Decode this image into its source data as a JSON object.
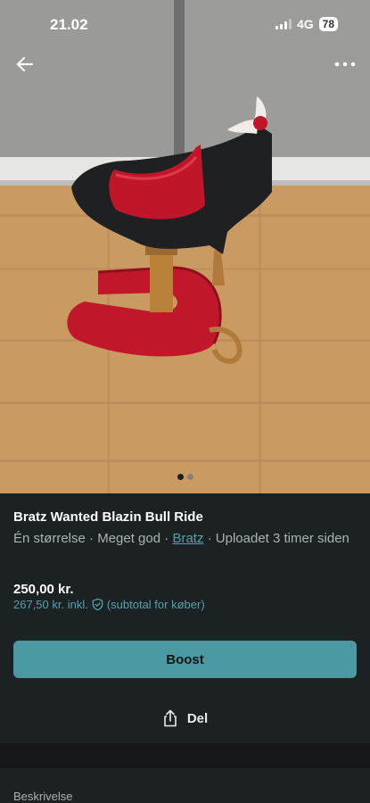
{
  "status_bar": {
    "time": "21.02",
    "network": "4G",
    "battery": "78"
  },
  "photo": {
    "carousel_total": 2,
    "carousel_active": 1
  },
  "icons": {
    "back": "arrow-left-icon",
    "more": "more-dots-icon",
    "shield": "shield-check-icon",
    "share": "share-icon"
  },
  "item": {
    "title": "Bratz Wanted Blazin Bull Ride",
    "size": "Én størrelse",
    "condition": "Meget god",
    "separator": " · ",
    "brand": "Bratz",
    "uploaded": "Uploadet 3 timer siden",
    "price": "250,00 kr.",
    "price_incl": "267,50 kr. inkl.",
    "price_incl_note": "(subtotal for køber)"
  },
  "actions": {
    "boost_label": "Boost",
    "share_label": "Del"
  },
  "description": {
    "label": "Beskrivelse"
  },
  "colors": {
    "accent": "#4b99a2",
    "link": "#4fa3ad",
    "background": "#1c2224"
  }
}
